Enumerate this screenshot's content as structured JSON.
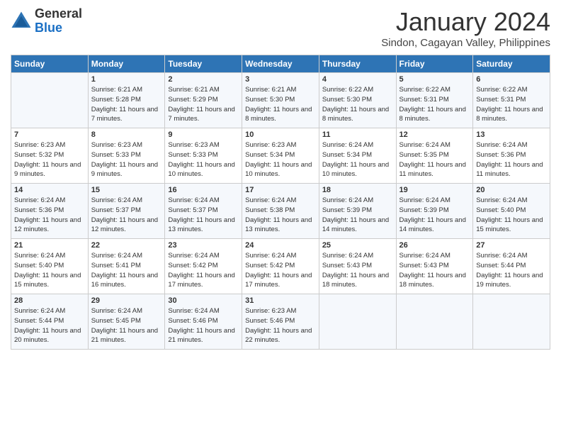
{
  "logo": {
    "general": "General",
    "blue": "Blue"
  },
  "header": {
    "title": "January 2024",
    "subtitle": "Sindon, Cagayan Valley, Philippines"
  },
  "days_of_week": [
    "Sunday",
    "Monday",
    "Tuesday",
    "Wednesday",
    "Thursday",
    "Friday",
    "Saturday"
  ],
  "weeks": [
    [
      {
        "day": "",
        "sunrise": "",
        "sunset": "",
        "daylight": ""
      },
      {
        "day": "1",
        "sunrise": "Sunrise: 6:21 AM",
        "sunset": "Sunset: 5:28 PM",
        "daylight": "Daylight: 11 hours and 7 minutes."
      },
      {
        "day": "2",
        "sunrise": "Sunrise: 6:21 AM",
        "sunset": "Sunset: 5:29 PM",
        "daylight": "Daylight: 11 hours and 7 minutes."
      },
      {
        "day": "3",
        "sunrise": "Sunrise: 6:21 AM",
        "sunset": "Sunset: 5:30 PM",
        "daylight": "Daylight: 11 hours and 8 minutes."
      },
      {
        "day": "4",
        "sunrise": "Sunrise: 6:22 AM",
        "sunset": "Sunset: 5:30 PM",
        "daylight": "Daylight: 11 hours and 8 minutes."
      },
      {
        "day": "5",
        "sunrise": "Sunrise: 6:22 AM",
        "sunset": "Sunset: 5:31 PM",
        "daylight": "Daylight: 11 hours and 8 minutes."
      },
      {
        "day": "6",
        "sunrise": "Sunrise: 6:22 AM",
        "sunset": "Sunset: 5:31 PM",
        "daylight": "Daylight: 11 hours and 8 minutes."
      }
    ],
    [
      {
        "day": "7",
        "sunrise": "Sunrise: 6:23 AM",
        "sunset": "Sunset: 5:32 PM",
        "daylight": "Daylight: 11 hours and 9 minutes."
      },
      {
        "day": "8",
        "sunrise": "Sunrise: 6:23 AM",
        "sunset": "Sunset: 5:33 PM",
        "daylight": "Daylight: 11 hours and 9 minutes."
      },
      {
        "day": "9",
        "sunrise": "Sunrise: 6:23 AM",
        "sunset": "Sunset: 5:33 PM",
        "daylight": "Daylight: 11 hours and 10 minutes."
      },
      {
        "day": "10",
        "sunrise": "Sunrise: 6:23 AM",
        "sunset": "Sunset: 5:34 PM",
        "daylight": "Daylight: 11 hours and 10 minutes."
      },
      {
        "day": "11",
        "sunrise": "Sunrise: 6:24 AM",
        "sunset": "Sunset: 5:34 PM",
        "daylight": "Daylight: 11 hours and 10 minutes."
      },
      {
        "day": "12",
        "sunrise": "Sunrise: 6:24 AM",
        "sunset": "Sunset: 5:35 PM",
        "daylight": "Daylight: 11 hours and 11 minutes."
      },
      {
        "day": "13",
        "sunrise": "Sunrise: 6:24 AM",
        "sunset": "Sunset: 5:36 PM",
        "daylight": "Daylight: 11 hours and 11 minutes."
      }
    ],
    [
      {
        "day": "14",
        "sunrise": "Sunrise: 6:24 AM",
        "sunset": "Sunset: 5:36 PM",
        "daylight": "Daylight: 11 hours and 12 minutes."
      },
      {
        "day": "15",
        "sunrise": "Sunrise: 6:24 AM",
        "sunset": "Sunset: 5:37 PM",
        "daylight": "Daylight: 11 hours and 12 minutes."
      },
      {
        "day": "16",
        "sunrise": "Sunrise: 6:24 AM",
        "sunset": "Sunset: 5:37 PM",
        "daylight": "Daylight: 11 hours and 13 minutes."
      },
      {
        "day": "17",
        "sunrise": "Sunrise: 6:24 AM",
        "sunset": "Sunset: 5:38 PM",
        "daylight": "Daylight: 11 hours and 13 minutes."
      },
      {
        "day": "18",
        "sunrise": "Sunrise: 6:24 AM",
        "sunset": "Sunset: 5:39 PM",
        "daylight": "Daylight: 11 hours and 14 minutes."
      },
      {
        "day": "19",
        "sunrise": "Sunrise: 6:24 AM",
        "sunset": "Sunset: 5:39 PM",
        "daylight": "Daylight: 11 hours and 14 minutes."
      },
      {
        "day": "20",
        "sunrise": "Sunrise: 6:24 AM",
        "sunset": "Sunset: 5:40 PM",
        "daylight": "Daylight: 11 hours and 15 minutes."
      }
    ],
    [
      {
        "day": "21",
        "sunrise": "Sunrise: 6:24 AM",
        "sunset": "Sunset: 5:40 PM",
        "daylight": "Daylight: 11 hours and 15 minutes."
      },
      {
        "day": "22",
        "sunrise": "Sunrise: 6:24 AM",
        "sunset": "Sunset: 5:41 PM",
        "daylight": "Daylight: 11 hours and 16 minutes."
      },
      {
        "day": "23",
        "sunrise": "Sunrise: 6:24 AM",
        "sunset": "Sunset: 5:42 PM",
        "daylight": "Daylight: 11 hours and 17 minutes."
      },
      {
        "day": "24",
        "sunrise": "Sunrise: 6:24 AM",
        "sunset": "Sunset: 5:42 PM",
        "daylight": "Daylight: 11 hours and 17 minutes."
      },
      {
        "day": "25",
        "sunrise": "Sunrise: 6:24 AM",
        "sunset": "Sunset: 5:43 PM",
        "daylight": "Daylight: 11 hours and 18 minutes."
      },
      {
        "day": "26",
        "sunrise": "Sunrise: 6:24 AM",
        "sunset": "Sunset: 5:43 PM",
        "daylight": "Daylight: 11 hours and 18 minutes."
      },
      {
        "day": "27",
        "sunrise": "Sunrise: 6:24 AM",
        "sunset": "Sunset: 5:44 PM",
        "daylight": "Daylight: 11 hours and 19 minutes."
      }
    ],
    [
      {
        "day": "28",
        "sunrise": "Sunrise: 6:24 AM",
        "sunset": "Sunset: 5:44 PM",
        "daylight": "Daylight: 11 hours and 20 minutes."
      },
      {
        "day": "29",
        "sunrise": "Sunrise: 6:24 AM",
        "sunset": "Sunset: 5:45 PM",
        "daylight": "Daylight: 11 hours and 21 minutes."
      },
      {
        "day": "30",
        "sunrise": "Sunrise: 6:24 AM",
        "sunset": "Sunset: 5:46 PM",
        "daylight": "Daylight: 11 hours and 21 minutes."
      },
      {
        "day": "31",
        "sunrise": "Sunrise: 6:23 AM",
        "sunset": "Sunset: 5:46 PM",
        "daylight": "Daylight: 11 hours and 22 minutes."
      },
      {
        "day": "",
        "sunrise": "",
        "sunset": "",
        "daylight": ""
      },
      {
        "day": "",
        "sunrise": "",
        "sunset": "",
        "daylight": ""
      },
      {
        "day": "",
        "sunrise": "",
        "sunset": "",
        "daylight": ""
      }
    ]
  ]
}
